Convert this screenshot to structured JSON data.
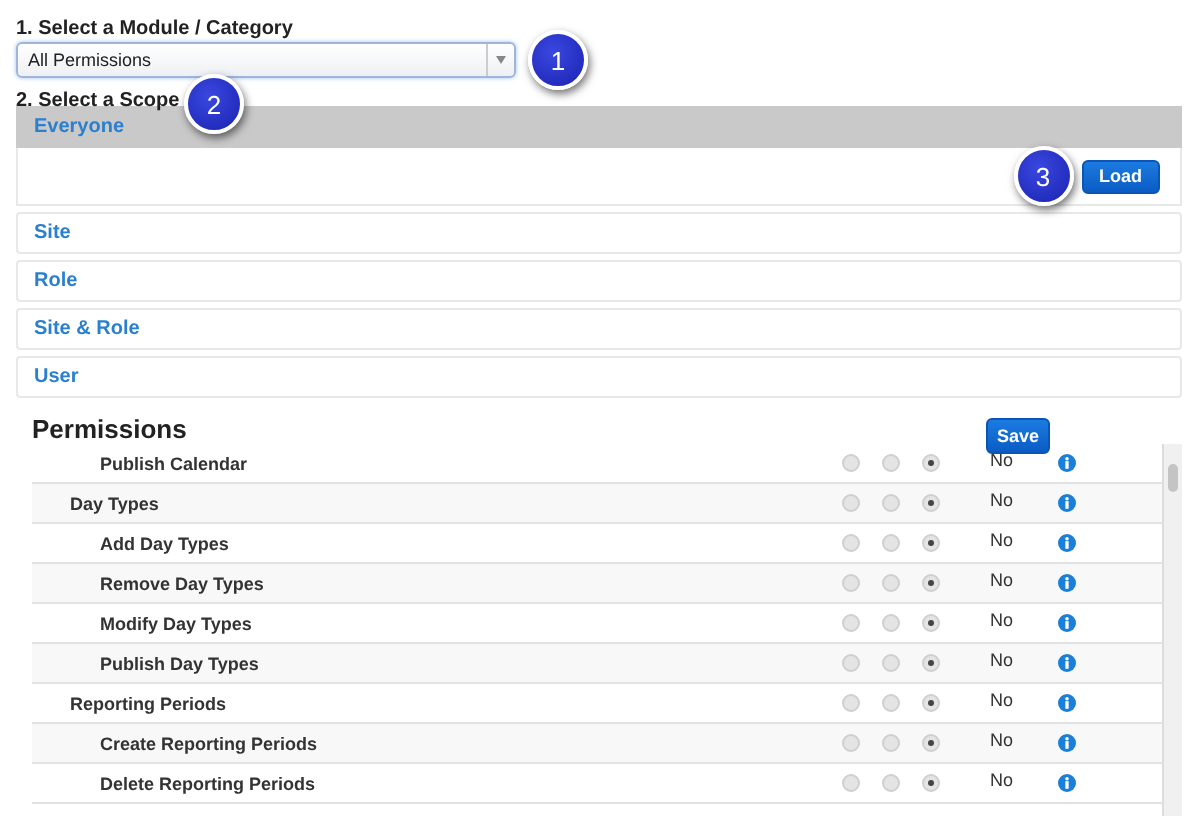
{
  "module": {
    "label": "1. Select a Module / Category",
    "value": "All Permissions",
    "badge": "1"
  },
  "scope": {
    "label": "2. Select a Scope",
    "badge": "2",
    "items": [
      {
        "label": "Everyone",
        "selected": true,
        "button": "Load",
        "badge": "3"
      },
      {
        "label": "Site",
        "selected": false
      },
      {
        "label": "Role",
        "selected": false
      },
      {
        "label": "Site & Role",
        "selected": false
      },
      {
        "label": "User",
        "selected": false
      }
    ]
  },
  "permissions": {
    "title": "Permissions",
    "save": "Save",
    "rows": [
      {
        "children": [
          {
            "name": "Publish Calendar",
            "value": "No",
            "access": [
              {
                "selected": false
              },
              {
                "selected": false
              },
              {
                "selected": true
              }
            ]
          }
        ]
      },
      {
        "name": "Day Types",
        "value": "No",
        "access": [
          {
            "selected": false
          },
          {
            "selected": false
          },
          {
            "selected": true
          }
        ],
        "children": [
          {
            "name": "Add Day Types",
            "value": "No",
            "access": [
              {
                "selected": false
              },
              {
                "selected": false
              },
              {
                "selected": true
              }
            ]
          },
          {
            "name": "Remove Day Types",
            "value": "No",
            "access": [
              {
                "selected": false
              },
              {
                "selected": false
              },
              {
                "selected": true
              }
            ]
          },
          {
            "name": "Modify Day Types",
            "value": "No",
            "access": [
              {
                "selected": false
              },
              {
                "selected": false
              },
              {
                "selected": true
              }
            ]
          },
          {
            "name": "Publish Day Types",
            "value": "No",
            "access": [
              {
                "selected": false
              },
              {
                "selected": false
              },
              {
                "selected": true
              }
            ]
          }
        ]
      },
      {
        "name": "Reporting Periods",
        "value": "No",
        "access": [
          {
            "selected": false
          },
          {
            "selected": false
          },
          {
            "selected": true
          }
        ],
        "children": [
          {
            "name": "Create Reporting Periods",
            "value": "No",
            "access": [
              {
                "selected": false
              },
              {
                "selected": false
              },
              {
                "selected": true
              }
            ]
          },
          {
            "name": "Delete Reporting Periods",
            "value": "No",
            "access": [
              {
                "selected": false
              },
              {
                "selected": false
              },
              {
                "selected": true
              }
            ]
          }
        ]
      }
    ]
  }
}
